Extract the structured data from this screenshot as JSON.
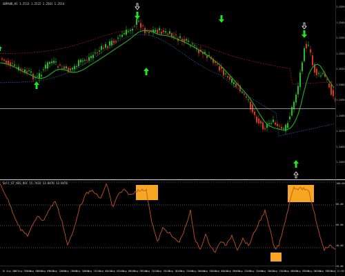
{
  "window": {
    "main_header": "GBPAUD,H1  1.2513 1.2522 1.2501 1.2514",
    "indicator_header": "Sell_ST_HIG_OSC  15.7432 13.8476 13.8476"
  },
  "price_axis": [
    "1.2555",
    "1.2545",
    "1.2535",
    "1.2525",
    "1.2515",
    "1.2505",
    "1.2495",
    "1.2485",
    "1.2475",
    "1.2465",
    "1.2455"
  ],
  "indicator_axis": [
    "100.00",
    "80.00",
    "60.00",
    "40.00",
    "20.00"
  ],
  "time_axis": [
    "10 Aug 2017",
    "10 Aug 03:00",
    "10 Aug 06:00",
    "10 Aug 09:00",
    "10 Aug 12:00",
    "10 Aug 15:00",
    "10 Aug 18:00",
    "10 Aug 21:00",
    "11 Aug 00:00",
    "11 Aug 03:00",
    "11 Aug 06:00",
    "11 Aug 09:00",
    "11 Aug 12:00",
    "11 Aug 15:00",
    "11 Aug 18:00",
    "11 Aug 21:00",
    "14 Aug 00:00",
    "14 Aug 03:00",
    "14 Aug 06:00",
    "14 Aug 09:00",
    "14 Aug 12:00",
    "14 Aug 15:00",
    "14 Aug 18:00",
    "14 Aug 21:00",
    "15 Aug 00:00",
    "15 Aug 03:00",
    "15 Aug 06:00",
    "15 Aug 09:00",
    "15 Aug 12:00"
  ],
  "colors": {
    "bull_candle": "#22c022",
    "bear_candle": "#d43a1a",
    "ma_green": "#21b021",
    "ma_red": "#8b1a1a",
    "ma_blue": "#2a5aa8",
    "oscillator": "#c0561e",
    "highlight_box": "#f5a623",
    "buy_arrow": "#1ee81e",
    "separator": "#d8d8d8",
    "level_dots": "#aaaaaa"
  },
  "icons": {
    "buy_signal": "up-arrow-icon",
    "sell_signal": "down-arrow-icon",
    "alert_marker": "hollow-arrow-icon"
  }
}
